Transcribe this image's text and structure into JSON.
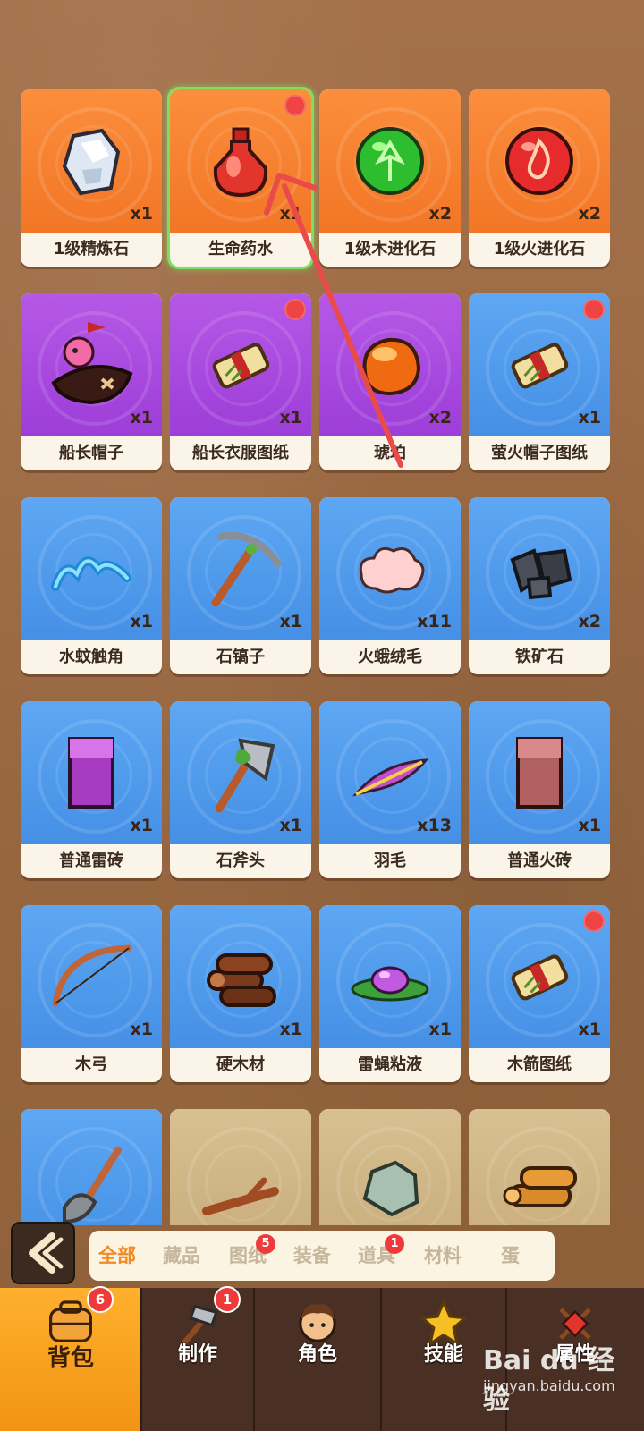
{
  "items": [
    {
      "name": "1级精炼石",
      "qty": "x1",
      "rarity": "orange",
      "icon": "crystal-icon",
      "dot": false,
      "selected": false
    },
    {
      "name": "生命药水",
      "qty": "x1",
      "rarity": "orange",
      "icon": "potion-icon",
      "dot": true,
      "selected": true
    },
    {
      "name": "1级木进化石",
      "qty": "x2",
      "rarity": "orange",
      "icon": "wood-orb-icon",
      "dot": false,
      "selected": false
    },
    {
      "name": "1级火进化石",
      "qty": "x2",
      "rarity": "orange",
      "icon": "fire-orb-icon",
      "dot": false,
      "selected": false
    },
    {
      "name": "船长帽子",
      "qty": "x1",
      "rarity": "purple",
      "icon": "captain-hat-icon",
      "dot": false,
      "selected": false
    },
    {
      "name": "船长衣服图纸",
      "qty": "x1",
      "rarity": "purple",
      "icon": "scroll-icon",
      "dot": true,
      "selected": false
    },
    {
      "name": "琥珀",
      "qty": "x2",
      "rarity": "purple",
      "icon": "amber-icon",
      "dot": false,
      "selected": false
    },
    {
      "name": "萤火帽子图纸",
      "qty": "x1",
      "rarity": "blue",
      "icon": "scroll-icon",
      "dot": true,
      "selected": false
    },
    {
      "name": "水蚊触角",
      "qty": "x1",
      "rarity": "blue",
      "icon": "antenna-icon",
      "dot": false,
      "selected": false
    },
    {
      "name": "石镐子",
      "qty": "x1",
      "rarity": "blue",
      "icon": "pickaxe-icon",
      "dot": false,
      "selected": false
    },
    {
      "name": "火蛾绒毛",
      "qty": "x11",
      "rarity": "blue",
      "icon": "fluff-icon",
      "dot": false,
      "selected": false
    },
    {
      "name": "铁矿石",
      "qty": "x2",
      "rarity": "blue",
      "icon": "iron-ore-icon",
      "dot": false,
      "selected": false
    },
    {
      "name": "普通雷砖",
      "qty": "x1",
      "rarity": "blue",
      "icon": "thunder-brick-icon",
      "dot": false,
      "selected": false
    },
    {
      "name": "石斧头",
      "qty": "x1",
      "rarity": "blue",
      "icon": "axe-icon",
      "dot": false,
      "selected": false
    },
    {
      "name": "羽毛",
      "qty": "x13",
      "rarity": "blue",
      "icon": "feather-icon",
      "dot": false,
      "selected": false
    },
    {
      "name": "普通火砖",
      "qty": "x1",
      "rarity": "blue",
      "icon": "fire-brick-icon",
      "dot": false,
      "selected": false
    },
    {
      "name": "木弓",
      "qty": "x1",
      "rarity": "blue",
      "icon": "bow-icon",
      "dot": false,
      "selected": false
    },
    {
      "name": "硬木材",
      "qty": "x1",
      "rarity": "blue",
      "icon": "logs-icon",
      "dot": false,
      "selected": false
    },
    {
      "name": "雷蝇粘液",
      "qty": "x1",
      "rarity": "blue",
      "icon": "slime-icon",
      "dot": false,
      "selected": false
    },
    {
      "name": "木箭图纸",
      "qty": "x1",
      "rarity": "blue",
      "icon": "scroll-icon",
      "dot": true,
      "selected": false
    },
    {
      "name": "",
      "qty": "",
      "rarity": "blue",
      "icon": "shovel-icon",
      "dot": false,
      "selected": false
    },
    {
      "name": "",
      "qty": "",
      "rarity": "tan",
      "icon": "branch-icon",
      "dot": false,
      "selected": false
    },
    {
      "name": "",
      "qty": "",
      "rarity": "tan",
      "icon": "stone-icon",
      "dot": false,
      "selected": false
    },
    {
      "name": "",
      "qty": "",
      "rarity": "tan",
      "icon": "lumber-icon",
      "dot": false,
      "selected": false
    }
  ],
  "filters": [
    {
      "label": "全部",
      "active": true,
      "badge": ""
    },
    {
      "label": "藏品",
      "active": false,
      "badge": ""
    },
    {
      "label": "图纸",
      "active": false,
      "badge": "5"
    },
    {
      "label": "装备",
      "active": false,
      "badge": ""
    },
    {
      "label": "道具",
      "active": false,
      "badge": "1"
    },
    {
      "label": "材料",
      "active": false,
      "badge": ""
    },
    {
      "label": "蛋",
      "active": false,
      "badge": ""
    }
  ],
  "nav": [
    {
      "label": "背包",
      "icon": "backpack-icon",
      "badge": "6",
      "active": true
    },
    {
      "label": "制作",
      "icon": "hammer-icon",
      "badge": "1",
      "active": false
    },
    {
      "label": "角色",
      "icon": "character-icon",
      "badge": "",
      "active": false
    },
    {
      "label": "技能",
      "icon": "star-icon",
      "badge": "",
      "active": false
    },
    {
      "label": "属性",
      "icon": "attribute-icon",
      "badge": "",
      "active": false
    }
  ],
  "watermark": {
    "brand": "Bai du 经验",
    "url": "jingyan.baidu.com"
  },
  "colors": {
    "orange": "#f27626",
    "purple": "#9c3ed8",
    "blue": "#4590e6",
    "accent": "#f28a1f",
    "badge": "#ee3a3a"
  }
}
